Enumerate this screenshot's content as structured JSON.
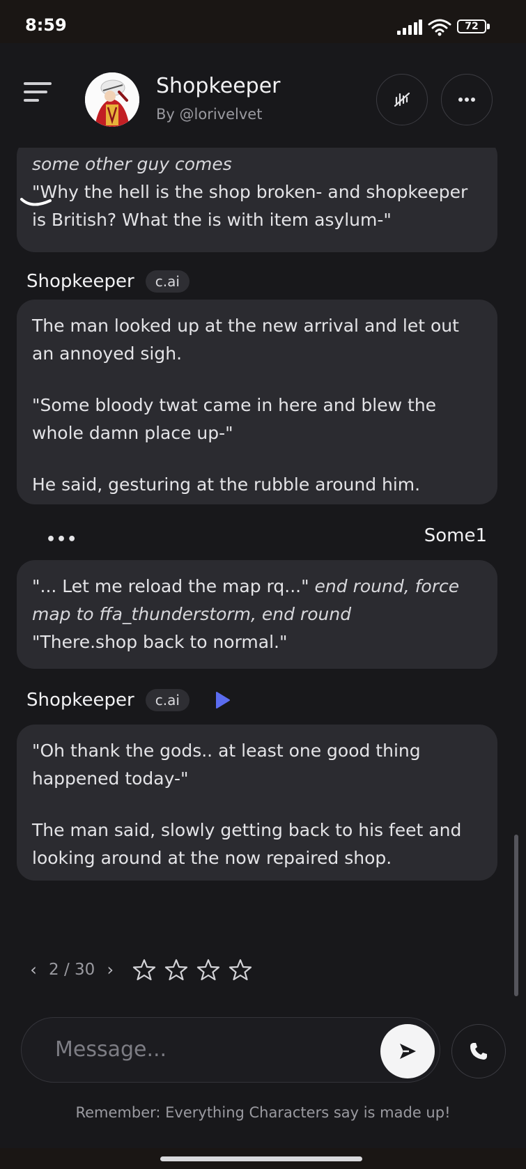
{
  "status_bar": {
    "time": "8:59",
    "battery": "72"
  },
  "header": {
    "character_name": "Shopkeeper",
    "author": "By @lorivelvet"
  },
  "messages": {
    "m1": {
      "line1": "some other guy comes",
      "line2": "\"Why the hell is the shop broken- and shopkeeper is British? What the is with item asylum-\""
    },
    "m2": {
      "speaker": "Shopkeeper",
      "badge": "c.ai",
      "p1": "The man looked up at the new arrival and let out an annoyed sigh.",
      "p2": "\"Some bloody twat came in here and blew the whole damn place up-\"",
      "p3": "He said, gesturing at the rubble around him."
    },
    "m3": {
      "menu_dots": "•••",
      "speaker": "Some1",
      "quote1": "\"... Let me reload the map rq...\"",
      "action": "end round, force map to ffa_thunderstorm, end round",
      "quote2": "\"There.shop back to normal.\""
    },
    "m4": {
      "speaker": "Shopkeeper",
      "badge": "c.ai",
      "p1": "\"Oh thank the gods.. at least one good thing happened today-\"",
      "p2": "The man said, slowly getting back to his feet and looking around at the now repaired shop."
    }
  },
  "pager": {
    "prev": "‹",
    "count": "2 / 30",
    "next": "›"
  },
  "rating": {
    "stars": 4,
    "filled": 0
  },
  "composer": {
    "placeholder": "Message..."
  },
  "disclaimer": "Remember: Everything Characters say is made up!",
  "colors": {
    "background": "#18181b",
    "bubble": "#2b2b30",
    "accent": "#5b6cf0"
  }
}
